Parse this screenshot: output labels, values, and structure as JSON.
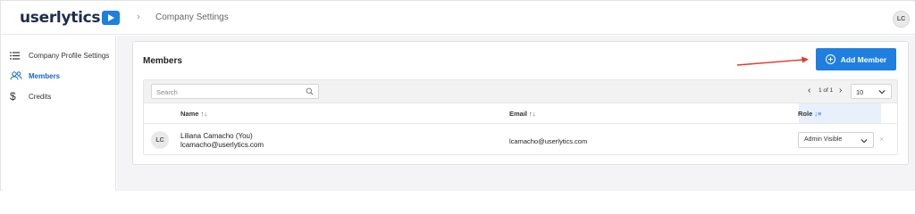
{
  "app": {
    "logo_text": "userlytics",
    "user_initials": "LC"
  },
  "breadcrumb": {
    "current": "Company Settings"
  },
  "sidebar": {
    "items": [
      {
        "label": "Company Profile Settings",
        "icon": "list-icon",
        "active": false
      },
      {
        "label": "Members",
        "icon": "users-icon",
        "active": true
      },
      {
        "label": "Credits",
        "icon": "dollar-icon",
        "active": false
      }
    ]
  },
  "members": {
    "title": "Members",
    "add_button_label": "Add Member",
    "search": {
      "placeholder": "Search",
      "value": ""
    },
    "pagination": {
      "text": "1 of 1",
      "per_page": "10"
    },
    "columns": [
      {
        "label": "Name",
        "sort": "↑↓"
      },
      {
        "label": "Email",
        "sort": "↑↓"
      },
      {
        "label": "Role",
        "sort": "↓≡"
      }
    ],
    "rows": [
      {
        "initials": "LC",
        "name": "Liliana Camacho (You)",
        "email_under_name": "lcamacho@userlytics.com",
        "email": "lcamacho@userlytics.com",
        "role": "Admin Visible",
        "remove": "×"
      }
    ]
  },
  "colors": {
    "accent": "#1f7fe0",
    "annotation_arrow": "#e0392b",
    "background": "#f4f4f6"
  }
}
